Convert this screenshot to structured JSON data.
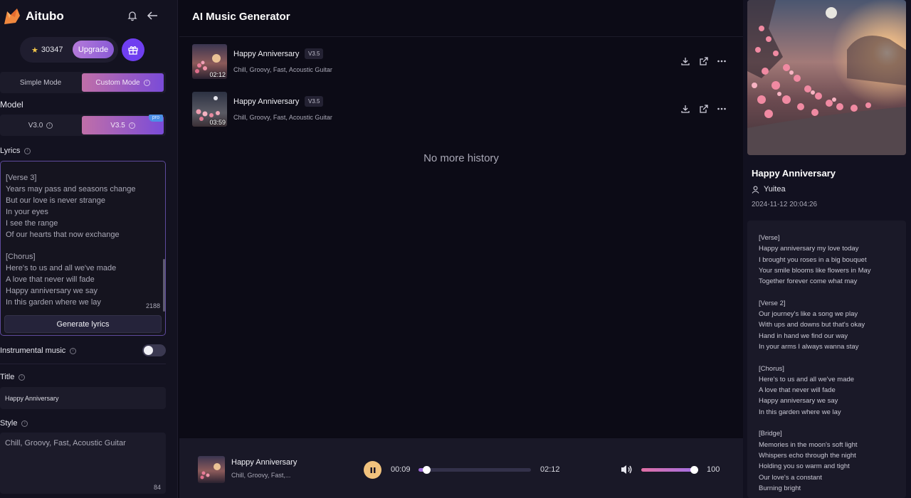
{
  "sidebar": {
    "brand": "Aitubo",
    "credits": "30347",
    "upgrade_label": "Upgrade",
    "modes": [
      "Simple Mode",
      "Custom Mode"
    ],
    "model_label": "Model",
    "versions": [
      "V3.0",
      "V3.5"
    ],
    "pro_badge": "pro",
    "lyrics_label": "Lyrics",
    "lyrics_text": "[Verse 3]\nYears may pass and seasons change\nBut our love is never strange\nIn your eyes\nI see the range\nOf our hearts that now exchange\n\n[Chorus]\nHere's to us and all we've made\nA love that never will fade\nHappy anniversary we say\nIn this garden where we lay",
    "lyrics_count": "2188",
    "generate_label": "Generate lyrics",
    "instrumental_label": "Instrumental music",
    "instrumental_on": false,
    "title_label": "Title",
    "title_value": "Happy Anniversary",
    "style_label": "Style",
    "style_value": "Chill, Groovy, Fast, Acoustic Guitar",
    "style_count": "84"
  },
  "main": {
    "title": "AI Music Generator",
    "songs": [
      {
        "name": "Happy Anniversary",
        "version": "V3.5",
        "tags": "Chill, Groovy, Fast, Acoustic Guitar",
        "duration": "02:12"
      },
      {
        "name": "Happy Anniversary",
        "version": "V3.5",
        "tags": "Chill, Groovy, Fast, Acoustic Guitar",
        "duration": "03:59"
      }
    ],
    "no_more": "No more history"
  },
  "player": {
    "name": "Happy Anniversary",
    "tags": "Chill, Groovy, Fast,...",
    "current": "00:09",
    "total": "02:12",
    "progress": 0.07,
    "volume": "100"
  },
  "detail": {
    "title": "Happy Anniversary",
    "author": "Yuitea",
    "date": "2024-11-12 20:04:26",
    "lyrics": "[Verse]\nHappy anniversary my love today\nI brought you roses in a big bouquet\nYour smile blooms like flowers in May\nTogether forever come what may\n\n[Verse 2]\nOur journey's like a song we play\nWith ups and downs but that's okay\nHand in hand we find our way\nIn your arms I always wanna stay\n\n[Chorus]\nHere's to us and all we've made\nA love that never will fade\nHappy anniversary we say\nIn this garden where we lay\n\n[Bridge]\nMemories in the moon's soft light\nWhispers echo through the night\nHolding you so warm and tight\nOur love's a constant\nBurning bright"
  },
  "colors": {
    "accent": "#7a4bd8",
    "pink": "#c06fa8",
    "play": "#f1c27d",
    "gift": "#6f3ff0"
  }
}
